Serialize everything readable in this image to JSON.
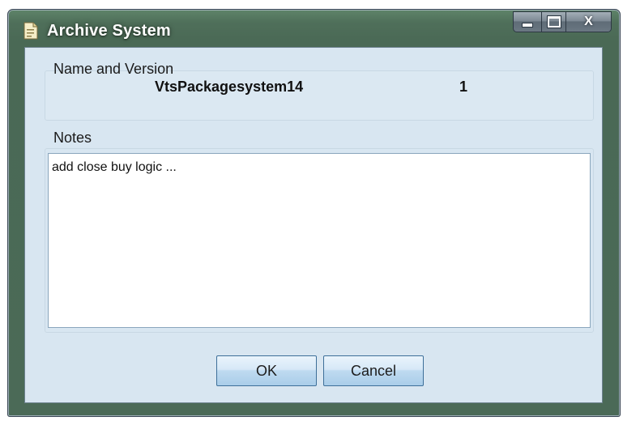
{
  "window": {
    "title": "Archive System",
    "app_icon": "document-icon",
    "controls": {
      "minimize": "minimize-icon",
      "maximize": "maximize-icon",
      "close": "X"
    }
  },
  "name_group": {
    "label": "Name and Version",
    "package_name": "VtsPackagesystem14",
    "version": "1"
  },
  "notes_group": {
    "label": "Notes",
    "text": "add close buy logic ..."
  },
  "buttons": {
    "ok_label": "OK",
    "cancel_label": "Cancel"
  },
  "colors": {
    "frame": "#4b6a57",
    "client_background": "#d8e6f1",
    "button_blue": "#bfdaf0"
  }
}
